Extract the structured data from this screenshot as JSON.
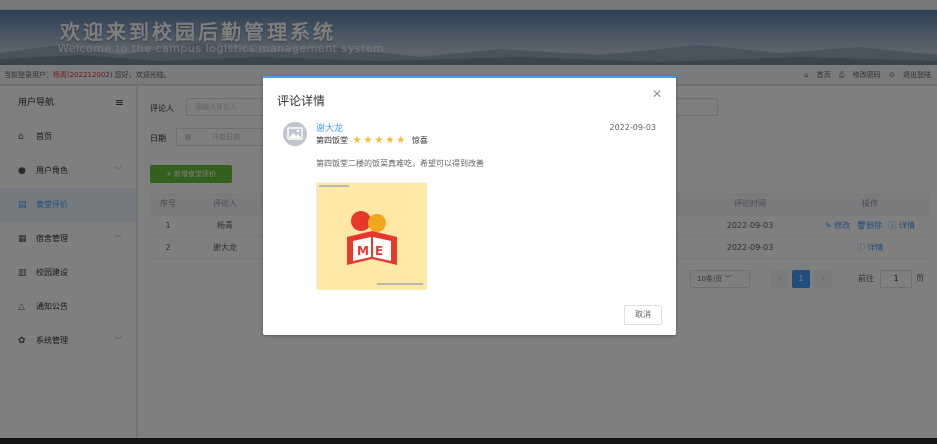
{
  "banner": {
    "title": "欢迎来到校园后勤管理系统",
    "subtitle": "Welcome to the campus logistics management system"
  },
  "infobar": {
    "prefix": "当前登录用户：",
    "user": "杨青(20221200",
    "suffix": "2) 您好，欢迎光临。",
    "links": [
      "首页",
      "修改密码",
      "退出登陆"
    ]
  },
  "sidebar": {
    "header": "用户导航",
    "items": [
      {
        "icon": "home-icon",
        "label": "首页"
      },
      {
        "icon": "user-icon",
        "label": "用户角色"
      },
      {
        "icon": "document-icon",
        "label": "食堂评价"
      },
      {
        "icon": "building-icon",
        "label": "宿舍管理"
      },
      {
        "icon": "construction-icon",
        "label": "校园建设"
      },
      {
        "icon": "bell-icon",
        "label": "通知公告"
      },
      {
        "icon": "gear-icon",
        "label": "系统管理"
      }
    ],
    "active_index": 2
  },
  "filters": {
    "reviewer_label": "评论人",
    "reviewer_placeholder": "请输入评论人",
    "date_label": "日期",
    "date_placeholder": "开始日期"
  },
  "toolbar": {
    "add_label": "+ 新增食堂评价"
  },
  "table": {
    "headers": [
      "序号",
      "评论人",
      "评论时间",
      "操作"
    ],
    "rows": [
      {
        "index": "1",
        "reviewer": "杨青",
        "time": "2022-09-03",
        "actions": [
          "修改",
          "删除",
          "详情"
        ]
      },
      {
        "index": "2",
        "reviewer": "谢大龙",
        "time": "2022-09-03",
        "actions": [
          "详情"
        ]
      }
    ]
  },
  "pagination": {
    "page_size": "10条/页",
    "current_page": "1",
    "goto_label": "前往",
    "goto_value": "1",
    "page_suffix": "页"
  },
  "dialog": {
    "title": "评论详情",
    "close_icon": "close-icon",
    "comment": {
      "name": "谢大龙",
      "date": "2022-09-03",
      "canteen": "第四饭堂",
      "rating": 5,
      "rating_text": "惊喜",
      "text": "第四饭堂二楼的饭菜真难吃，希望可以得到改善"
    },
    "cancel_label": "取消"
  },
  "colors": {
    "accent": "#409eff",
    "success": "#67c23a",
    "star": "#f7ba2a",
    "danger": "#e4393c"
  }
}
